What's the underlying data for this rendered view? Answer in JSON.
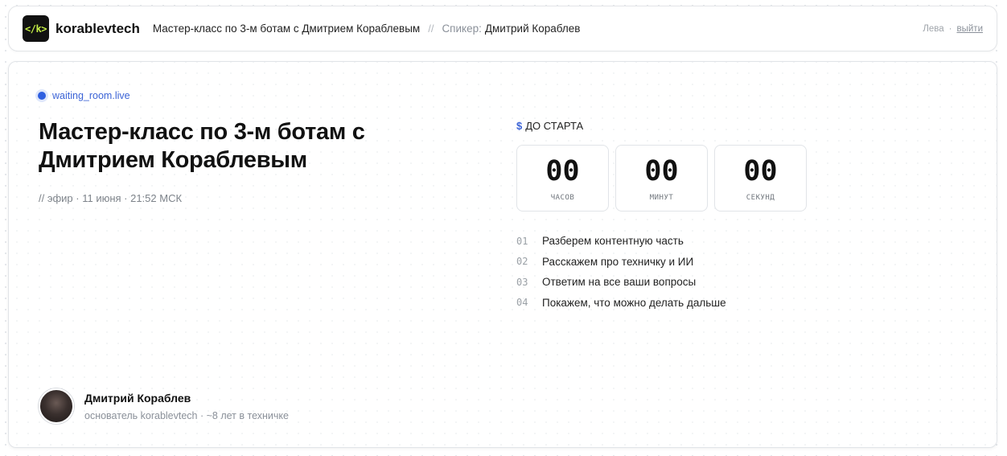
{
  "header": {
    "logo_text": "</k>",
    "brand": "korablevtech",
    "event_title": "Мастер-класс по 3-м ботам с Дмитрием Кораблевым",
    "separator": "//",
    "speaker_label": "Спикер:",
    "speaker_name": "Дмитрий Кораблев",
    "user_name": "Лева",
    "dot": "·",
    "logout_label": "выйти"
  },
  "colors": {
    "accent": "#3b63d6",
    "logo_glyph": "#c6f046",
    "logo_bg": "#111111"
  },
  "main": {
    "live_badge": "waiting_room.live",
    "title": "Мастер-класс по 3-м ботам с Дмитрием Кораблевым",
    "meta": "// эфир · 11 июня · 21:52 МСК"
  },
  "countdown": {
    "icon": "$",
    "label": "ДО СТАРТА",
    "items": [
      {
        "value": "00",
        "unit": "ЧАСОВ"
      },
      {
        "value": "00",
        "unit": "МИНУТ"
      },
      {
        "value": "00",
        "unit": "СЕКУНД"
      }
    ]
  },
  "agenda": [
    {
      "num": "01",
      "text": "Разберем контентную часть"
    },
    {
      "num": "02",
      "text": "Расскажем про техничку и ИИ"
    },
    {
      "num": "03",
      "text": "Ответим на все ваши вопросы"
    },
    {
      "num": "04",
      "text": "Покажем, что можно делать дальше"
    }
  ],
  "author": {
    "name": "Дмитрий Кораблев",
    "role": "основатель korablevtech · ~8 лет в техничке"
  }
}
